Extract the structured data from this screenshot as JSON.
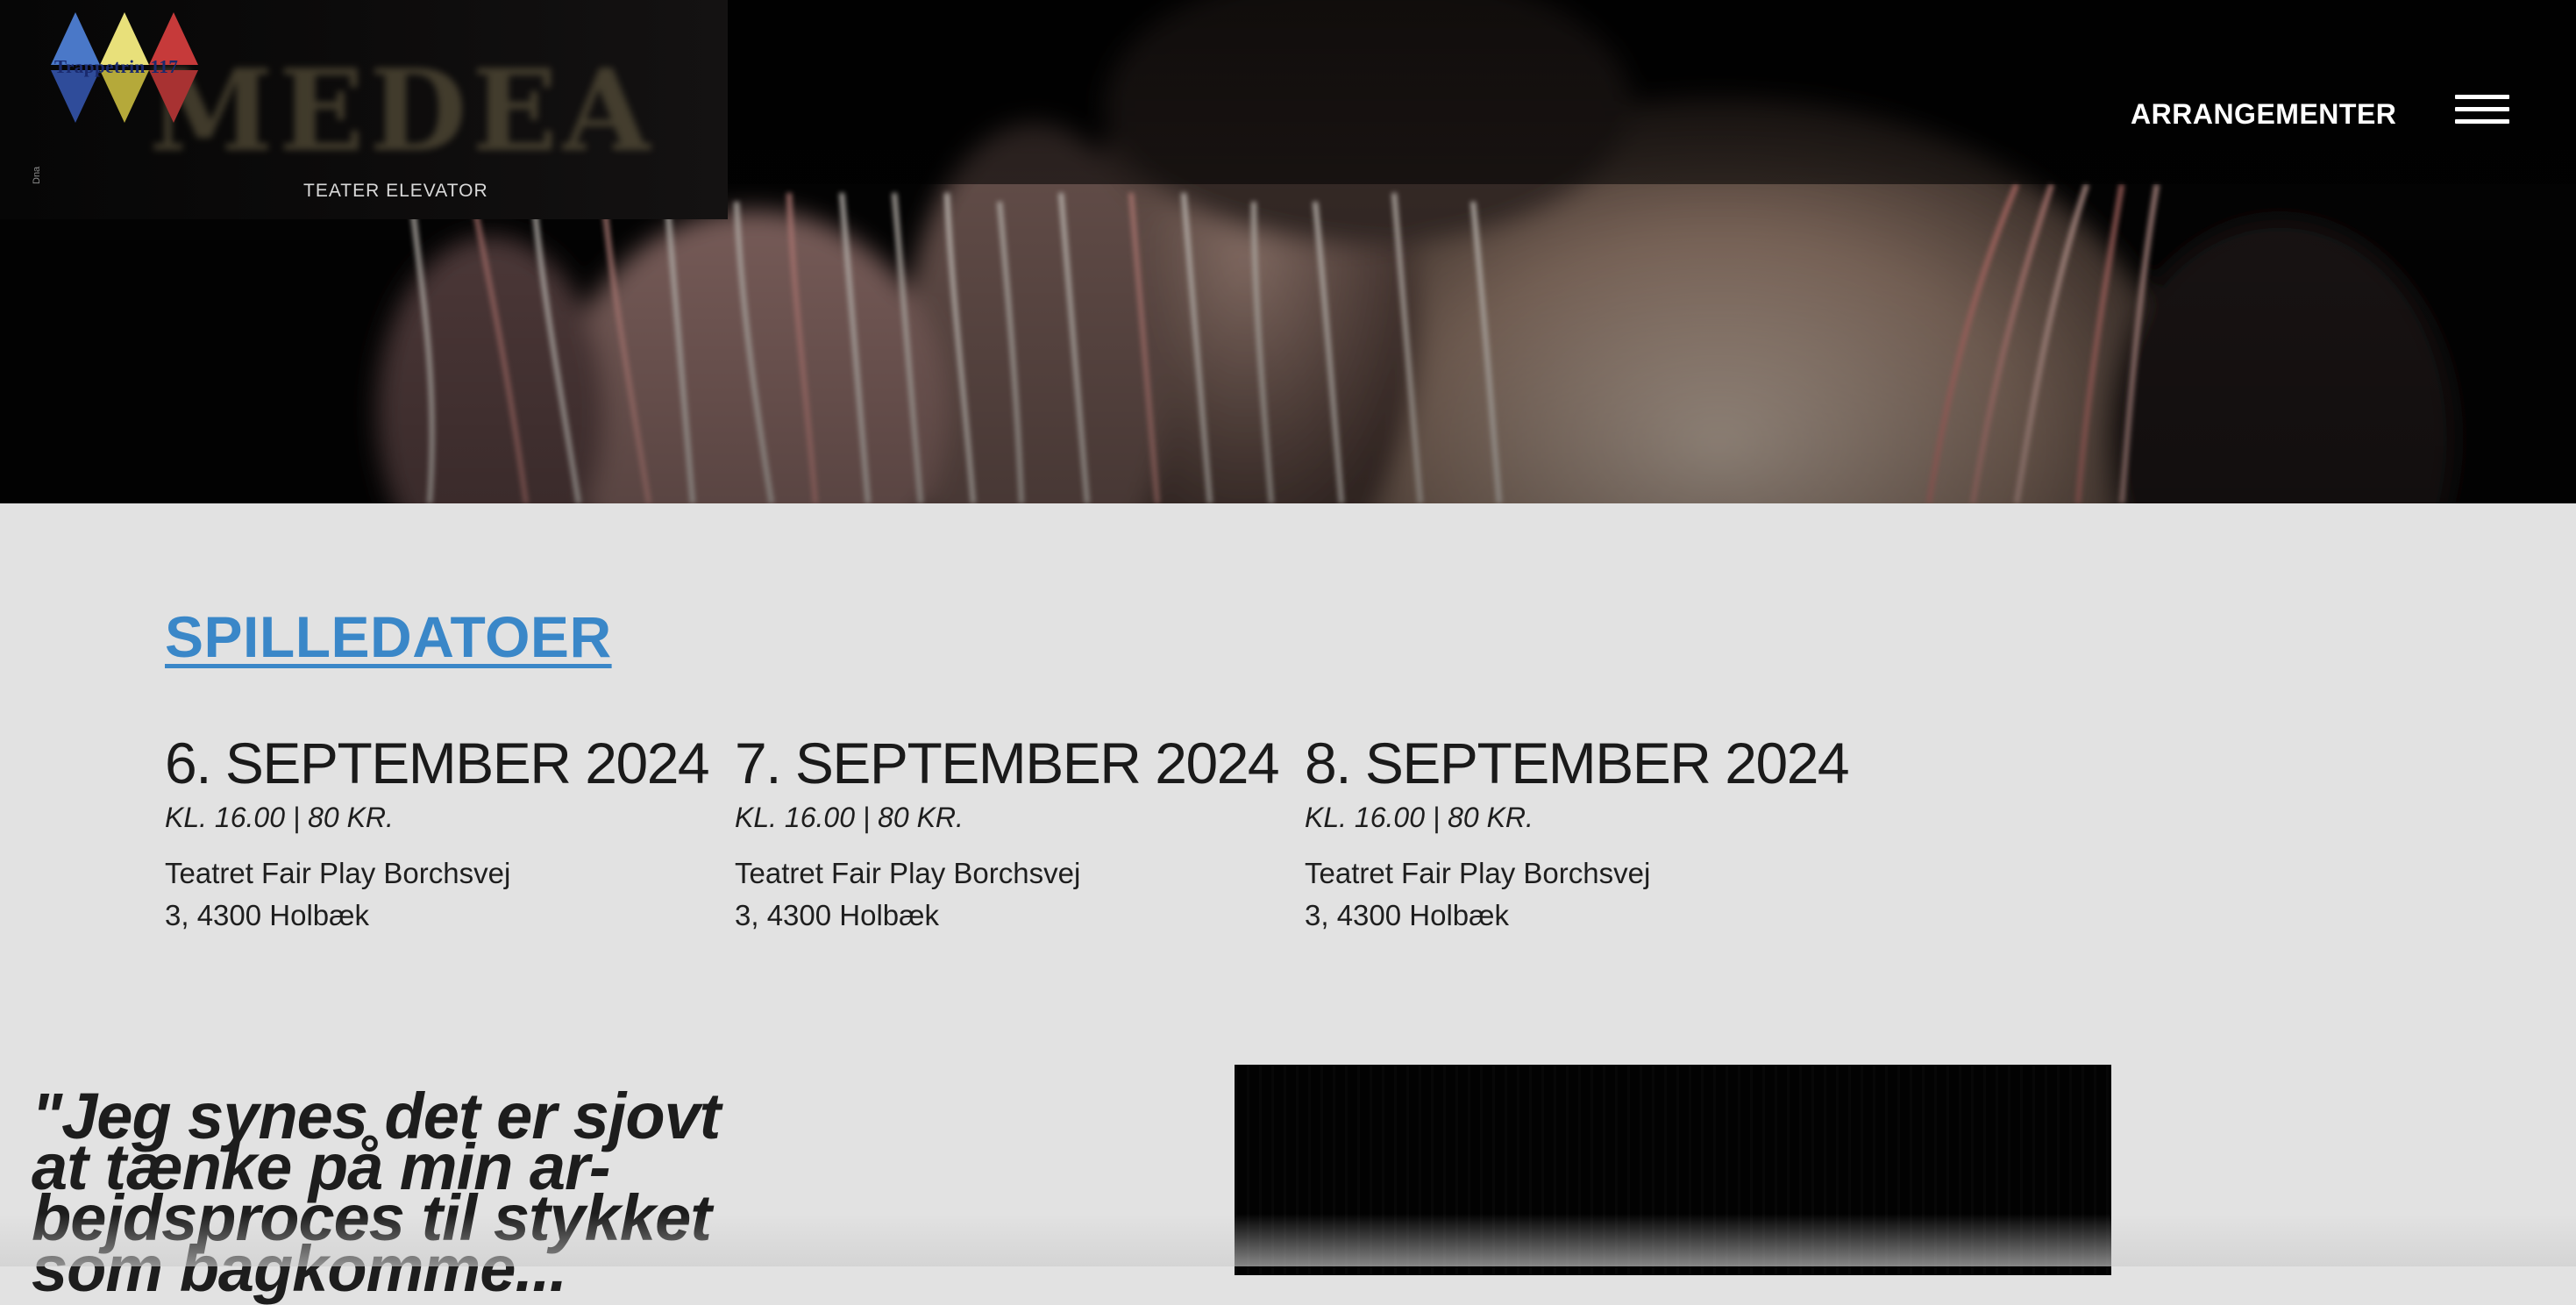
{
  "header": {
    "nav_link": "ARRANGEMENTER",
    "menu_icon": "hamburger-menu-icon",
    "logo_text": "Trappetrin 117",
    "logo_colors": [
      "#4a78c8",
      "#e8e07a",
      "#c63a3a",
      "#2f4c9a",
      "#b5a93a",
      "#a83232"
    ]
  },
  "hero": {
    "poster_title": "MEDEA",
    "poster_subtitle": "TEATER ELEVATOR",
    "poster_side_text": "Dna"
  },
  "dates_section": {
    "title": "SPILLEDATOER",
    "title_color": "#3a87c8",
    "dates": [
      {
        "heading": "6. SEPTEMBER 2024",
        "meta": "KL. 16.00  |  80 KR.",
        "venue": "Teatret Fair Play Borchsvej\n3, 4300 Holbæk"
      },
      {
        "heading": "7. SEPTEMBER 2024",
        "meta": "KL. 16.00  |  80 KR.",
        "venue": "Teatret Fair Play Borchsvej\n3, 4300 Holbæk"
      },
      {
        "heading": "8. SEPTEMBER 2024",
        "meta": "KL. 16.00  |  80 KR.",
        "venue": "Teatret Fair Play Borchsvej\n3, 4300 Holbæk"
      }
    ]
  },
  "quote": {
    "text": "\"Jeg synes det er sjovt at tænke på min ar­bejdsproces til styk­ket som bagkomme..."
  },
  "colors": {
    "page_background": "#e2e2e2",
    "hero_background": "#020202",
    "text": "#1c1c1c"
  }
}
